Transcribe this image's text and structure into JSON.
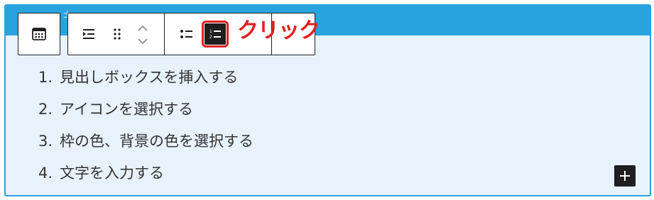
{
  "box": {
    "border_color": "#29a3de",
    "background_color": "#e8f2fc",
    "header_glyph": "±"
  },
  "list": {
    "items": [
      {
        "number": "1.",
        "text": "見出しボックスを挿入する"
      },
      {
        "number": "2.",
        "text": "アイコンを選択する"
      },
      {
        "number": "3.",
        "text": "枠の色、背景の色を選択する"
      },
      {
        "number": "4.",
        "text": "文字を入力する"
      }
    ]
  },
  "toolbar": {
    "block_type_icon": "calendar-block-icon",
    "list_indent_icon": "list-indent-icon",
    "drag_handle_icon": "drag-handle-icon",
    "move_up_icon": "chevron-up-icon",
    "move_down_icon": "chevron-down-icon",
    "unordered_list_icon": "bulleted-list-icon",
    "ordered_list_icon": "numbered-list-icon",
    "ordered_list_active": true,
    "active_outline_color": "#e02020"
  },
  "annotation": {
    "text": "クリック",
    "color": "#e02020"
  },
  "add_button": {
    "icon": "plus-icon"
  }
}
